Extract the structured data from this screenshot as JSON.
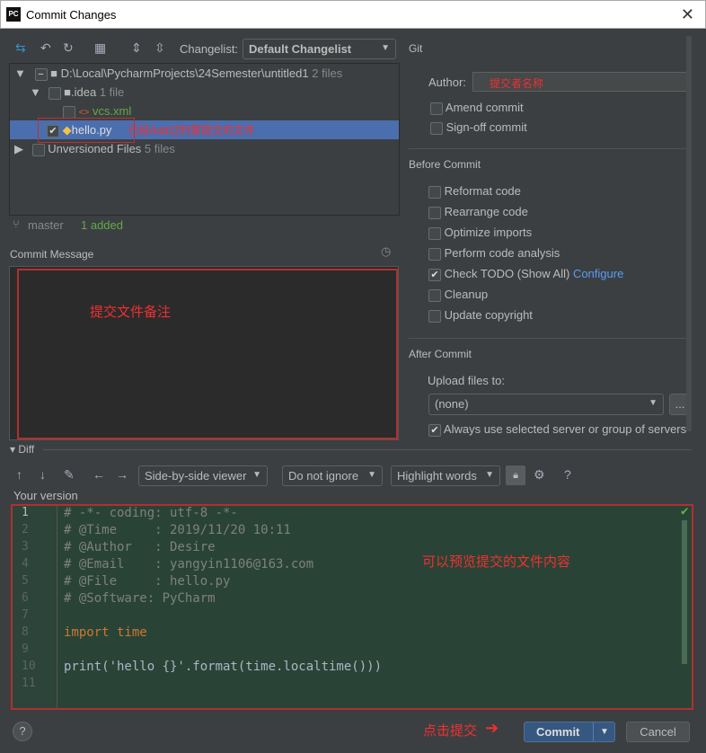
{
  "window": {
    "title": "Commit Changes",
    "logo": "PC"
  },
  "toolbar": {
    "changelist_label": "Changelist:",
    "changelist_value": "Default Changelist"
  },
  "tree": {
    "root": {
      "path": "D:\\Local\\PycharmProjects\\24Semester\\untitled1",
      "count": "2 files"
    },
    "idea": {
      "name": ".idea",
      "count": "1 file"
    },
    "vcs": {
      "name": "vcs.xml"
    },
    "hello": {
      "name": "hello.py",
      "annotation": "已经Add过的要提交的文件"
    },
    "unversioned": {
      "name": "Unversioned Files",
      "count": "5 files"
    }
  },
  "status": {
    "branch": "master",
    "summary": "1 added"
  },
  "commit_message": {
    "label": "Commit Message",
    "annotation": "提交文件备注"
  },
  "git": {
    "label": "Git",
    "author_label": "Author:",
    "author_value": "提交者名称",
    "amend": "Amend commit",
    "signoff": "Sign-off commit"
  },
  "before_commit": {
    "label": "Before Commit",
    "items": [
      "Reformat code",
      "Rearrange code",
      "Optimize imports",
      "Perform code analysis",
      "Check TODO (Show All)",
      "Cleanup",
      "Update copyright"
    ],
    "configure": "Configure"
  },
  "after_commit": {
    "label": "After Commit",
    "upload_label": "Upload files to:",
    "upload_value": "(none)",
    "browse": "...",
    "always_use": "Always use selected server or group of servers"
  },
  "diff": {
    "label": "Diff",
    "viewer": "Side-by-side viewer",
    "ignore": "Do not ignore",
    "highlight": "Highlight words",
    "help": "?",
    "your_version": "Your version",
    "annotation": "可以预览提交的文件内容"
  },
  "code": {
    "line_numbers": [
      "1",
      "2",
      "3",
      "4",
      "5",
      "6",
      "7",
      "8",
      "9",
      "10",
      "11"
    ],
    "lines": [
      "# -*- coding: utf-8 -*-",
      "# @Time     : 2019/11/20 10:11",
      "# @Author   : Desire",
      "# @Email    : yangyin1106@163.com",
      "# @File     : hello.py",
      "# @Software: PyCharm",
      "",
      "import time",
      "",
      "print('hello {}'.format(time.localtime()))",
      ""
    ]
  },
  "footer": {
    "help": "?",
    "annotation": "点击提交",
    "commit": "Commit",
    "cancel": "Cancel"
  }
}
